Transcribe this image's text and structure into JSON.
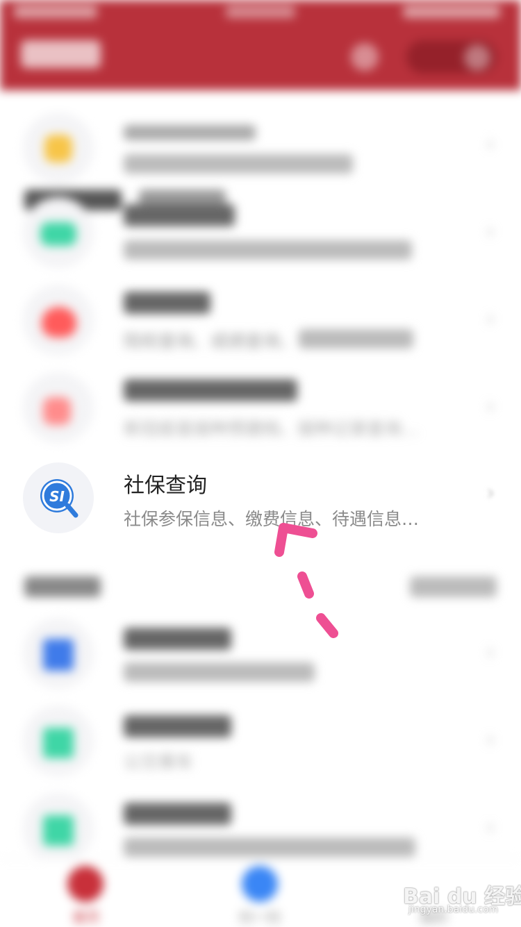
{
  "social_security_item": {
    "title": "社保查询",
    "subtitle": "社保参保信息、缴费信息、待遇信息…"
  },
  "visible_partial_text": {
    "item3_subtitle": "院校查询、成绩查询、",
    "item4_subtitle": "新冠疫苗接种预建档、接种记录查询…",
    "item7_subtitle": "公交乘车"
  },
  "tabbar": {
    "tab1_label": "首页",
    "tab2_label": "扫一扫",
    "tab3_label": "我的"
  },
  "watermark": {
    "brand": "Bai du 经验",
    "domain": "jingyan.baidu.com"
  },
  "colors": {
    "header_red": "#b8313b",
    "si_icon_blue": "#2f7bdc",
    "annotation_pink": "#ee4f93"
  }
}
